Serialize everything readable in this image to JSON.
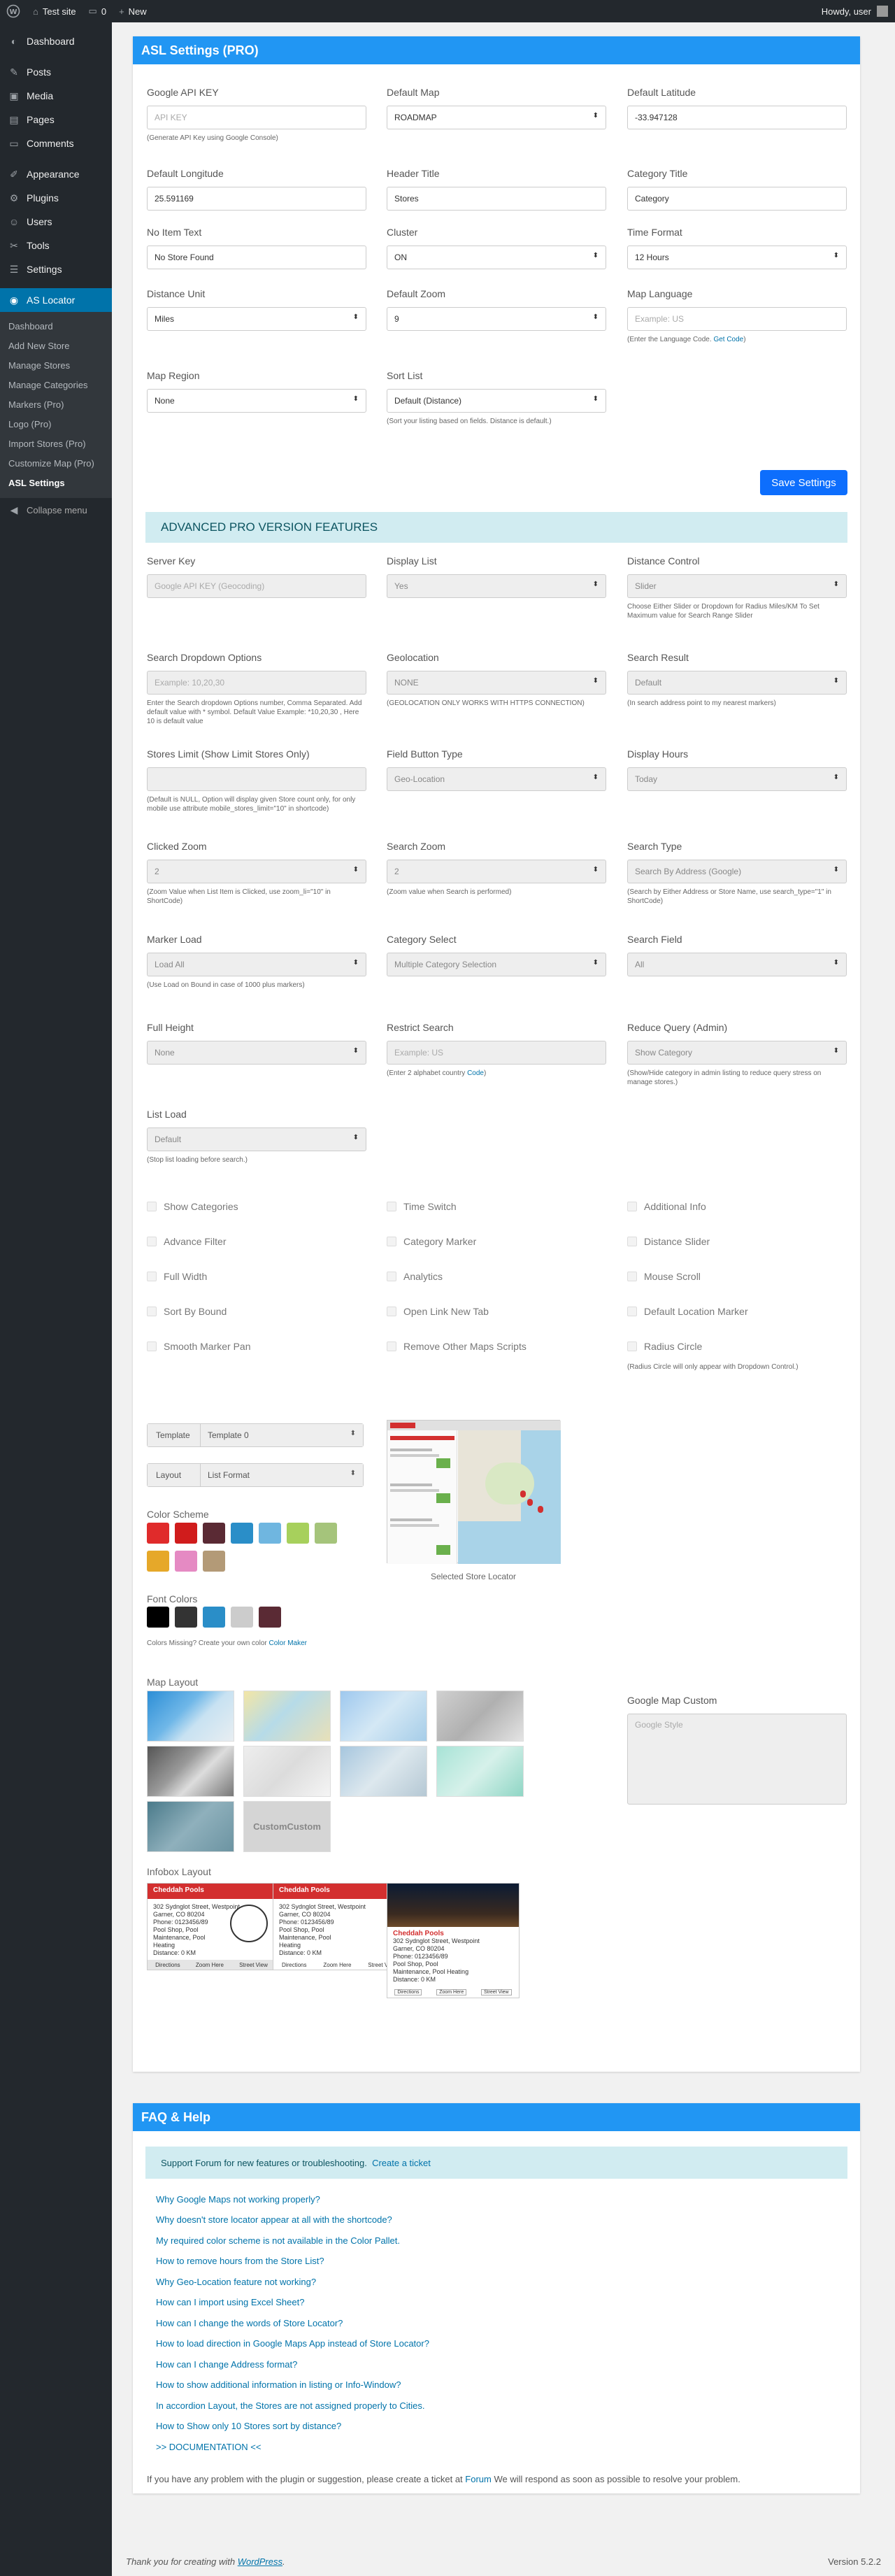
{
  "adminbar": {
    "site": "Test site",
    "comments": "0",
    "new": "New",
    "howdy": "Howdy, user"
  },
  "sidebar": {
    "items": [
      {
        "label": "Dashboard",
        "icon": "dashboard-icon"
      },
      {
        "label": "Posts",
        "icon": "pin-icon"
      },
      {
        "label": "Media",
        "icon": "media-icon"
      },
      {
        "label": "Pages",
        "icon": "pages-icon"
      },
      {
        "label": "Comments",
        "icon": "comment-icon"
      },
      {
        "label": "Appearance",
        "icon": "brush-icon"
      },
      {
        "label": "Plugins",
        "icon": "plugin-icon"
      },
      {
        "label": "Users",
        "icon": "users-icon"
      },
      {
        "label": "Tools",
        "icon": "wrench-icon"
      },
      {
        "label": "Settings",
        "icon": "settings-icon"
      },
      {
        "label": "AS Locator",
        "icon": "location-icon"
      }
    ],
    "submenu": [
      "Dashboard",
      "Add New Store",
      "Manage Stores",
      "Manage Categories",
      "Markers (Pro)",
      "Logo (Pro)",
      "Import Stores (Pro)",
      "Customize Map (Pro)",
      "ASL Settings"
    ],
    "collapse": "Collapse menu"
  },
  "settings": {
    "title": "ASL Settings (PRO)",
    "api_key": {
      "label": "Google API KEY",
      "placeholder": "API KEY",
      "hint": "(Generate API Key using Google Console)"
    },
    "default_map": {
      "label": "Default Map",
      "value": "ROADMAP"
    },
    "default_latitude": {
      "label": "Default Latitude",
      "value": "-33.947128"
    },
    "default_longitude": {
      "label": "Default Longitude",
      "value": "25.591169"
    },
    "header_title": {
      "label": "Header Title",
      "value": "Stores"
    },
    "category_title": {
      "label": "Category Title",
      "value": "Category"
    },
    "no_item_text": {
      "label": "No Item Text",
      "value": "No Store Found"
    },
    "cluster": {
      "label": "Cluster",
      "value": "ON"
    },
    "time_format": {
      "label": "Time Format",
      "value": "12 Hours"
    },
    "distance_unit": {
      "label": "Distance Unit",
      "value": "Miles"
    },
    "default_zoom": {
      "label": "Default Zoom",
      "value": "9"
    },
    "map_language": {
      "label": "Map Language",
      "placeholder": "Example: US",
      "hint": "(Enter the Language Code.",
      "hint_link": "Get Code",
      "hint_end": ")"
    },
    "map_region": {
      "label": "Map Region",
      "value": "None"
    },
    "sort_list": {
      "label": "Sort List",
      "value": "Default (Distance)",
      "hint": "(Sort your listing based on fields. Distance is default.)"
    },
    "save_label": "Save Settings",
    "advanced_title": "ADVANCED PRO VERSION FEATURES",
    "server_key": {
      "label": "Server Key",
      "placeholder": "Google API KEY (Geocoding)"
    },
    "display_list": {
      "label": "Display List",
      "value": "Yes"
    },
    "distance_control": {
      "label": "Distance Control",
      "value": "Slider",
      "hint": "Choose Either Slider or Dropdown for Radius Miles/KM To Set Maximum value for Search Range Slider"
    },
    "search_dropdown": {
      "label": "Search Dropdown Options",
      "placeholder": "Example: 10,20,30",
      "hint": "Enter the Search dropdown Options number, Comma Separated. Add default value with * symbol. Default Value Example: *10,20,30 , Here 10 is default value"
    },
    "geolocation": {
      "label": "Geolocation",
      "value": "NONE",
      "hint": "(GEOLOCATION ONLY WORKS WITH HTTPS CONNECTION)"
    },
    "search_result": {
      "label": "Search Result",
      "value": "Default",
      "hint": "(In search address point to my nearest markers)"
    },
    "stores_limit": {
      "label": "Stores Limit (Show Limit Stores Only)",
      "hint": "(Default is NULL, Option will display given Store count only, for only mobile use attribute mobile_stores_limit=\"10\" in shortcode)"
    },
    "field_button_type": {
      "label": "Field Button Type",
      "value": "Geo-Location"
    },
    "display_hours": {
      "label": "Display Hours",
      "value": "Today"
    },
    "clicked_zoom": {
      "label": "Clicked Zoom",
      "value": "2",
      "hint": "(Zoom Value when List Item is Clicked, use zoom_li=\"10\" in ShortCode)"
    },
    "search_zoom": {
      "label": "Search Zoom",
      "value": "2",
      "hint": "(Zoom value when Search is performed)"
    },
    "search_type": {
      "label": "Search Type",
      "value": "Search By Address (Google)",
      "hint": "(Search by Either Address or Store Name, use search_type=\"1\" in ShortCode)"
    },
    "marker_load": {
      "label": "Marker Load",
      "value": "Load All",
      "hint": "(Use Load on Bound in case of 1000 plus markers)"
    },
    "category_select": {
      "label": "Category Select",
      "value": "Multiple Category Selection"
    },
    "search_field": {
      "label": "Search Field",
      "value": "All"
    },
    "full_height": {
      "label": "Full Height",
      "value": "None"
    },
    "restrict_search": {
      "label": "Restrict Search",
      "placeholder": "Example: US",
      "hint": "(Enter 2 alphabet country",
      "hint_link": "Code",
      "hint_end": ")"
    },
    "reduce_query": {
      "label": "Reduce Query (Admin)",
      "value": "Show Category",
      "hint": "(Show/Hide category in admin listing to reduce query stress on manage stores.)"
    },
    "list_load": {
      "label": "List Load",
      "value": "Default",
      "hint": "(Stop list loading before search.)"
    },
    "checkboxes": [
      "Show Categories",
      "Time Switch",
      "Additional Info",
      "Advance Filter",
      "Category Marker",
      "Distance Slider",
      "Full Width",
      "Analytics",
      "Mouse Scroll",
      "Sort By Bound",
      "Open Link New Tab",
      "Default Location Marker",
      "Smooth Marker Pan",
      "Remove Other Maps Scripts",
      "Radius Circle"
    ],
    "radius_hint": "(Radius Circle will only appear with Dropdown Control.)",
    "template": {
      "label": "Template",
      "value": "Template 0"
    },
    "layout": {
      "label": "Layout",
      "value": "List Format"
    },
    "selected_locator": "Selected Store Locator",
    "color_scheme_title": "Color Scheme",
    "color_scheme": [
      "#e02b2b",
      "#d01c1c",
      "#5a2a34",
      "#2a8ec8",
      "#6fb6e0",
      "#a7d05c",
      "#a5c47b",
      "#e6a829",
      "#e58ac3",
      "#b39a77"
    ],
    "font_colors_title": "Font Colors",
    "font_colors": [
      "#000000",
      "#333333",
      "#2a8ec8",
      "#cccccc",
      "#5a2a34"
    ],
    "colors_hint": "Colors Missing? Create your own color",
    "colors_hint_link": "Color Maker",
    "map_layout_title": "Map Layout",
    "custom_tile": "CustomCustom",
    "google_map_custom": {
      "label": "Google Map Custom",
      "placeholder": "Google Style"
    },
    "infobox_title": "Infobox Layout",
    "infobox": {
      "name": "Cheddah Pools",
      "address": "302 Sydnglot Street, Westpoint",
      "city": "Garner, CO 80204",
      "phone": "Phone: 0123456/89",
      "lines": "Pool Shop, Pool Maintenance, Pool Heating",
      "distance": "Distance: 0 KM",
      "b1": "Directions",
      "b2": "Zoom Here",
      "b3": "Street View"
    }
  },
  "faq": {
    "title": "FAQ & Help",
    "support": "Support Forum for new features or troubleshooting.",
    "support_link": "Create a ticket",
    "links": [
      "Why Google Maps not working properly?",
      "Why doesn't store locator appear at all with the shortcode?",
      "My required color scheme is not available in the Color Pallet.",
      "How to remove hours from the Store List?",
      "Why Geo-Location feature not working?",
      "How can I import using Excel Sheet?",
      "How can I change the words of Store Locator?",
      "How to load direction in Google Maps App instead of Store Locator?",
      "How can I change Address format?",
      "How to show additional information in listing or Info-Window?",
      "In accordion Layout, the Stores are not assigned properly to Cities.",
      "How to Show only 10 Stores sort by distance?",
      ">> DOCUMENTATION <<"
    ],
    "note_pre": "If you have any problem with the plugin or suggestion, please create a ticket at",
    "note_link": "Forum",
    "note_post": "We will respond as soon as possible to resolve your problem."
  },
  "footer": {
    "text": "Thank you for creating with",
    "link": "WordPress",
    "version": "Version 5.2.2"
  }
}
